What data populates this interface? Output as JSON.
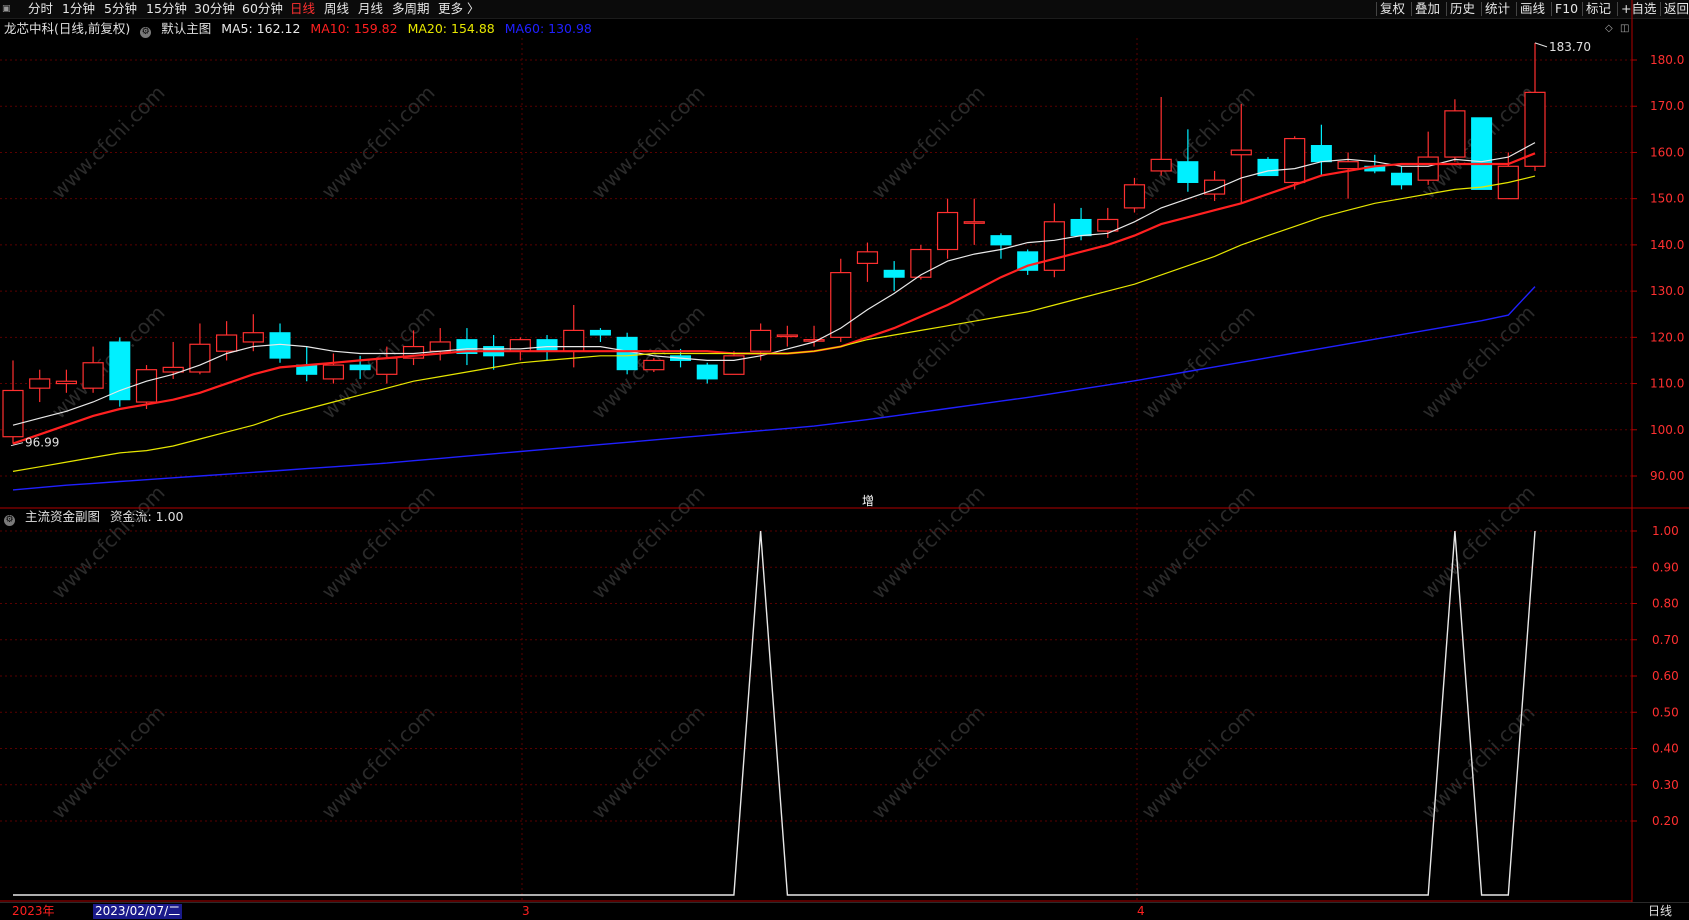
{
  "toolbar": {
    "left_items": [
      "分时",
      "1分钟",
      "5分钟",
      "15分钟",
      "30分钟",
      "60分钟",
      "日线",
      "周线",
      "月线",
      "多周期",
      "更多 〉"
    ],
    "active_item": "日线",
    "right_items": [
      "复权",
      "叠加",
      "历史",
      "统计",
      "画线",
      "F10",
      "标记",
      "+自选",
      "返回"
    ]
  },
  "main_chart": {
    "stock_name": "龙芯中科(日线,前复权)",
    "indicator_name": "默认主图",
    "ma_labels": [
      {
        "text": "MA5: 162.12",
        "color": "#e8e8e8"
      },
      {
        "text": "MA10: 159.82",
        "color": "#ff2020"
      },
      {
        "text": "MA20: 154.88",
        "color": "#e6e600"
      },
      {
        "text": "MA60: 130.98",
        "color": "#2020ff"
      }
    ],
    "high_label": "183.70",
    "low_label": "96.99",
    "y_ticks": [
      "180.0",
      "170.0",
      "160.0",
      "150.0",
      "140.0",
      "130.0",
      "120.0",
      "110.0",
      "100.0",
      "90.00"
    ],
    "marker": "增"
  },
  "sub_chart": {
    "title": "主流资金副图",
    "value_label": "资金流: 1.00",
    "y_ticks": [
      "1.00",
      "0.90",
      "0.80",
      "0.70",
      "0.60",
      "0.50",
      "0.40",
      "0.30",
      "0.20"
    ]
  },
  "bottom_axis": {
    "dates": [
      {
        "text": "2023年",
        "color": "#ff2020"
      },
      {
        "text": "2023/02/07/二",
        "color": "#ffffff",
        "highlight": true
      },
      {
        "text": "3",
        "color": "#ff2020"
      },
      {
        "text": "4",
        "color": "#ff2020"
      }
    ],
    "period": "日线"
  },
  "watermark": "www.cfchi.com",
  "colors": {
    "up": "#ff3030",
    "down": "#00f0ff",
    "ma5": "#e8e8e8",
    "ma10": "#ff2020",
    "ma20": "#e6e600",
    "ma60": "#2020ff",
    "grid": "#5a0000"
  },
  "chart_data": [
    {
      "type": "candlestick",
      "title": "龙芯中科(日线,前复权)",
      "ylim": [
        86,
        187
      ],
      "candles": [
        {
          "o": 98.5,
          "c": 108.5,
          "h": 115,
          "l": 96.99
        },
        {
          "o": 109,
          "c": 111,
          "h": 113,
          "l": 106
        },
        {
          "o": 110,
          "c": 110.5,
          "h": 113,
          "l": 108
        },
        {
          "o": 109,
          "c": 114.5,
          "h": 118,
          "l": 108
        },
        {
          "o": 119,
          "c": 106.5,
          "h": 120,
          "l": 105
        },
        {
          "o": 106,
          "c": 113,
          "h": 114,
          "l": 104.5
        },
        {
          "o": 112.5,
          "c": 113.5,
          "h": 119,
          "l": 111
        },
        {
          "o": 112.5,
          "c": 118.5,
          "h": 123,
          "l": 112
        },
        {
          "o": 117,
          "c": 120.5,
          "h": 123.5,
          "l": 115
        },
        {
          "o": 119,
          "c": 121,
          "h": 125,
          "l": 117
        },
        {
          "o": 121,
          "c": 115.5,
          "h": 123,
          "l": 114.5
        },
        {
          "o": 114,
          "c": 112,
          "h": 118,
          "l": 110.5
        },
        {
          "o": 111,
          "c": 114,
          "h": 116.5,
          "l": 110
        },
        {
          "o": 114,
          "c": 113,
          "h": 116,
          "l": 111
        },
        {
          "o": 112,
          "c": 115.5,
          "h": 118,
          "l": 110
        },
        {
          "o": 115.5,
          "c": 118,
          "h": 121.5,
          "l": 114
        },
        {
          "o": 117,
          "c": 119,
          "h": 122,
          "l": 115
        },
        {
          "o": 119.5,
          "c": 116.5,
          "h": 122,
          "l": 114
        },
        {
          "o": 118,
          "c": 116,
          "h": 120.5,
          "l": 113
        },
        {
          "o": 117,
          "c": 119.5,
          "h": 120,
          "l": 115
        },
        {
          "o": 119.5,
          "c": 117,
          "h": 120.5,
          "l": 115
        },
        {
          "o": 117,
          "c": 121.5,
          "h": 127,
          "l": 113.5
        },
        {
          "o": 121.5,
          "c": 120.5,
          "h": 122,
          "l": 119
        },
        {
          "o": 120,
          "c": 113,
          "h": 121,
          "l": 112
        },
        {
          "o": 113,
          "c": 115,
          "h": 115.5,
          "l": 112.5
        },
        {
          "o": 116,
          "c": 115,
          "h": 117.5,
          "l": 113.5
        },
        {
          "o": 114,
          "c": 111,
          "h": 114.5,
          "l": 110
        },
        {
          "o": 112,
          "c": 116,
          "h": 117,
          "l": 112
        },
        {
          "o": 117,
          "c": 121.5,
          "h": 123,
          "l": 115
        },
        {
          "o": 120.5,
          "c": 120.5,
          "h": 122.5,
          "l": 118
        },
        {
          "o": 119.5,
          "c": 119.5,
          "h": 122.5,
          "l": 118
        },
        {
          "o": 120,
          "c": 134,
          "h": 137,
          "l": 119
        },
        {
          "o": 136,
          "c": 138.5,
          "h": 140.5,
          "l": 132
        },
        {
          "o": 134.5,
          "c": 133,
          "h": 136.5,
          "l": 130
        },
        {
          "o": 133,
          "c": 139,
          "h": 140,
          "l": 132.5
        },
        {
          "o": 139,
          "c": 147,
          "h": 150,
          "l": 137
        },
        {
          "o": 145,
          "c": 145,
          "h": 150,
          "l": 140
        },
        {
          "o": 142,
          "c": 140,
          "h": 142.5,
          "l": 137
        },
        {
          "o": 138.5,
          "c": 134.5,
          "h": 139,
          "l": 133.5
        },
        {
          "o": 134.5,
          "c": 145,
          "h": 149,
          "l": 133
        },
        {
          "o": 145.5,
          "c": 142,
          "h": 148,
          "l": 141
        },
        {
          "o": 143,
          "c": 145.5,
          "h": 148,
          "l": 141.5
        },
        {
          "o": 148,
          "c": 153,
          "h": 154.5,
          "l": 147
        },
        {
          "o": 156,
          "c": 158.5,
          "h": 172,
          "l": 155
        },
        {
          "o": 158,
          "c": 153.5,
          "h": 165,
          "l": 151.5
        },
        {
          "o": 151,
          "c": 154,
          "h": 156,
          "l": 149.5
        },
        {
          "o": 159.5,
          "c": 160.5,
          "h": 170.5,
          "l": 149
        },
        {
          "o": 158.5,
          "c": 155,
          "h": 159,
          "l": 155
        },
        {
          "o": 153.5,
          "c": 163,
          "h": 163.5,
          "l": 152
        },
        {
          "o": 161.5,
          "c": 158,
          "h": 166,
          "l": 155
        },
        {
          "o": 156.5,
          "c": 158,
          "h": 160,
          "l": 150
        },
        {
          "o": 157,
          "c": 156,
          "h": 159.5,
          "l": 155.5
        },
        {
          "o": 155.5,
          "c": 153,
          "h": 157,
          "l": 152
        },
        {
          "o": 154,
          "c": 159,
          "h": 164.5,
          "l": 153
        },
        {
          "o": 159,
          "c": 169,
          "h": 171.5,
          "l": 158
        },
        {
          "o": 167.5,
          "c": 152,
          "h": 167.5,
          "l": 152
        },
        {
          "o": 150,
          "c": 157,
          "h": 160,
          "l": 150
        },
        {
          "o": 157,
          "c": 173,
          "h": 183.7,
          "l": 156
        }
      ],
      "series": [
        {
          "name": "MA5",
          "values": [
            101,
            102.5,
            104,
            106,
            108.5,
            110.5,
            112,
            114,
            116.5,
            118,
            118.5,
            118,
            117,
            116.5,
            116.5,
            116.5,
            117,
            117.5,
            117.5,
            117.5,
            118,
            118,
            118,
            117,
            116,
            115.5,
            115,
            115,
            116,
            117.5,
            119,
            122,
            126,
            129.5,
            133.5,
            136.5,
            138,
            139,
            140.5,
            141,
            142,
            142.5,
            145,
            148,
            150,
            152,
            154.5,
            156,
            156.5,
            158,
            158.5,
            158,
            157,
            157,
            158.5,
            158,
            159,
            162.12
          ]
        },
        {
          "name": "MA10",
          "values": [
            97,
            99,
            101,
            103,
            104.5,
            105.5,
            106.5,
            108,
            110,
            112,
            113.5,
            114,
            114.5,
            115,
            115.5,
            116,
            116.5,
            117,
            117,
            117,
            117,
            117,
            117,
            117,
            117,
            117,
            117,
            116.5,
            116.5,
            116.5,
            117,
            118,
            120,
            122,
            124.5,
            127,
            130,
            133,
            135.5,
            137,
            138.5,
            140,
            142,
            144.5,
            146,
            147.5,
            149,
            151,
            153,
            155,
            156,
            157,
            157.5,
            157.5,
            157.5,
            157.5,
            157.5,
            159.82
          ]
        },
        {
          "name": "MA20",
          "values": [
            91,
            92,
            93,
            94,
            95,
            95.5,
            96.5,
            98,
            99.5,
            101,
            103,
            104.5,
            106,
            107.5,
            109,
            110.5,
            111.5,
            112.5,
            113.5,
            114.5,
            115,
            115.5,
            116,
            116,
            116.5,
            116.5,
            116.5,
            116.5,
            116.5,
            116.5,
            117,
            118,
            119.5,
            120.5,
            121.5,
            122.5,
            123.5,
            124.5,
            125.5,
            127,
            128.5,
            130,
            131.5,
            133.5,
            135.5,
            137.5,
            140,
            142,
            144,
            146,
            147.5,
            149,
            150,
            151,
            152,
            152.5,
            153.5,
            154.88
          ]
        },
        {
          "name": "MA60",
          "values": [
            87,
            87.5,
            88,
            88.4,
            88.8,
            89.2,
            89.6,
            90,
            90.4,
            90.8,
            91.2,
            91.6,
            92,
            92.4,
            92.8,
            93.3,
            93.8,
            94.3,
            94.8,
            95.3,
            95.8,
            96.3,
            96.8,
            97.3,
            97.8,
            98.3,
            98.8,
            99.3,
            99.8,
            100.3,
            100.8,
            101.5,
            102.2,
            103,
            103.8,
            104.6,
            105.4,
            106.2,
            107,
            107.9,
            108.8,
            109.7,
            110.6,
            111.6,
            112.6,
            113.6,
            114.6,
            115.6,
            116.6,
            117.6,
            118.6,
            119.6,
            120.6,
            121.6,
            122.6,
            123.6,
            124.8,
            130.98
          ]
        }
      ]
    },
    {
      "type": "line",
      "title": "主流资金副图",
      "ylim": [
        0.1,
        1.0
      ],
      "series": [
        {
          "name": "资金流",
          "values": [
            0,
            0,
            0,
            0,
            0,
            0,
            0,
            0,
            0,
            0,
            0,
            0,
            0,
            0,
            0,
            0,
            0,
            0,
            0,
            0,
            0,
            0,
            0,
            0,
            0,
            0,
            0,
            0,
            1,
            0,
            0,
            0,
            0,
            0,
            0,
            0,
            0,
            0,
            0,
            0,
            0,
            0,
            0,
            0,
            0,
            0,
            0,
            0,
            0,
            0,
            0,
            0,
            0,
            0,
            1,
            0,
            0,
            1
          ]
        }
      ]
    }
  ]
}
